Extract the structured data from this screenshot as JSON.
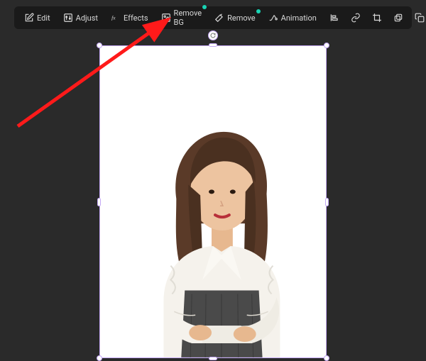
{
  "toolbar": {
    "edit_label": "Edit",
    "adjust_label": "Adjust",
    "effects_label": "Effects",
    "remove_bg_label": "Remove BG",
    "remove_label": "Remove",
    "animation_label": "Animation"
  },
  "icons": {
    "edit": "edit-icon",
    "adjust": "adjust-icon",
    "effects": "effects-icon",
    "remove_bg": "remove-bg-icon",
    "remove": "remove-icon",
    "animation": "animation-icon",
    "align": "align-icon",
    "link": "link-icon",
    "crop": "crop-icon",
    "layers": "layers-icon",
    "copy": "copy-icon",
    "delete": "delete-icon",
    "rotate": "rotate-icon"
  },
  "annotation": {
    "color": "#ff1a1a"
  },
  "selection": {
    "border_color": "#c4a8f5"
  }
}
